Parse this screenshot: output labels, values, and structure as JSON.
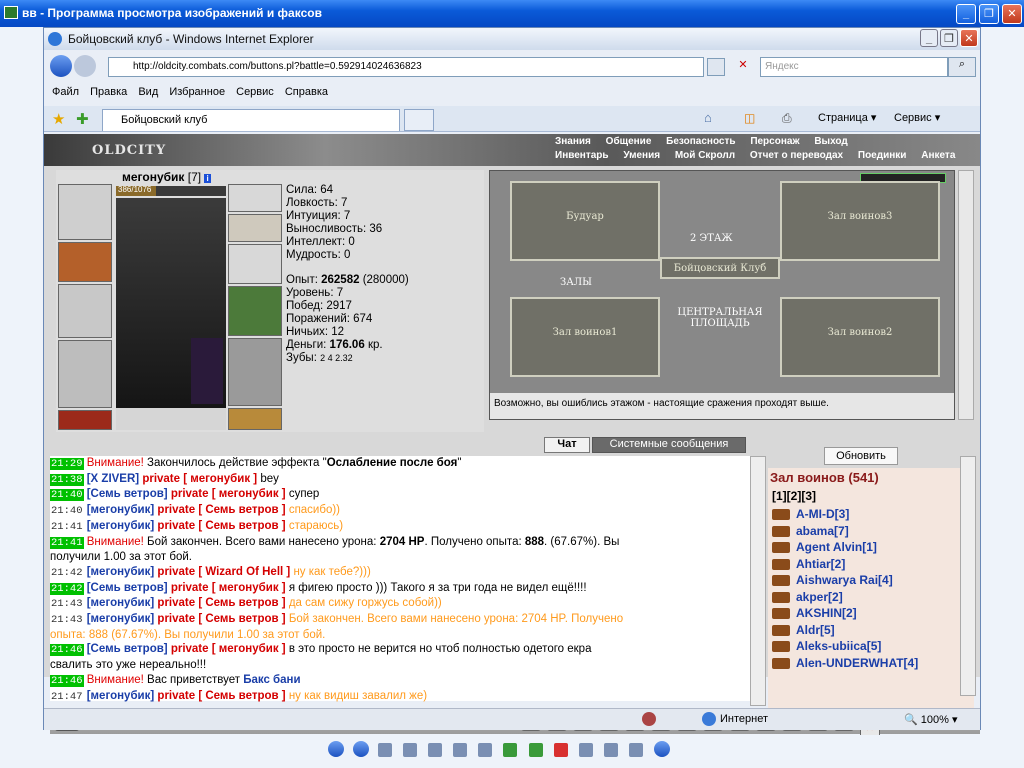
{
  "os_window": {
    "title": "вв - Программа просмотра изображений и факсов",
    "buttons": [
      "_",
      "❐",
      "✕"
    ]
  },
  "ie": {
    "title": "Бойцовский клуб - Windows Internet Explorer",
    "url": "http://oldcity.combats.com/buttons.pl?battle=0.592914024636823",
    "search_placeholder": "Яндекс",
    "menu": [
      "Файл",
      "Правка",
      "Вид",
      "Избранное",
      "Сервис",
      "Справка"
    ],
    "tab_title": "Бойцовский клуб",
    "toolbar_right": {
      "page": "Страница",
      "service": "Сервис"
    },
    "status": {
      "zone": "Интернет",
      "zoom": "100%"
    }
  },
  "game": {
    "logo": "OLDCITY",
    "menu_row1": [
      "Знания",
      "Общение",
      "Безопасность",
      "Персонаж",
      "Выход"
    ],
    "menu_row2": [
      "Инвентарь",
      "Умения",
      "Мой Скролл",
      "Отчет о переводах",
      "Поединки",
      "Анкета"
    ],
    "character": {
      "name": "мегонубик",
      "level": "[7]",
      "hp": "386/1076"
    },
    "stats": [
      {
        "label": "Сила",
        "value": "64"
      },
      {
        "label": "Ловкость",
        "value": "7"
      },
      {
        "label": "Интуиция",
        "value": "7"
      },
      {
        "label": "Выносливость",
        "value": "36"
      },
      {
        "label": "Интеллект",
        "value": "0"
      },
      {
        "label": "Мудрость",
        "value": "0"
      }
    ],
    "exp": {
      "label": "Опыт",
      "value": "262582",
      "next": "(280000)"
    },
    "stats2": [
      {
        "label": "Уровень",
        "value": "7"
      },
      {
        "label": "Побед",
        "value": "2917"
      },
      {
        "label": "Поражений",
        "value": "674"
      },
      {
        "label": "Ничьих",
        "value": "12"
      }
    ],
    "money": {
      "label": "Деньги",
      "value": "176.06",
      "unit": "кр."
    },
    "teeth": {
      "label": "Зубы",
      "value": "2 4 2.32"
    },
    "map": {
      "rooms": [
        "Будуар",
        "Зал воинов3",
        "2 ЭТАЖ",
        "Бойцовский Клуб",
        "ЗАЛЫ",
        "ЦЕНТРАЛЬНАЯ ПЛОЩАДЬ",
        "Зал воинов1",
        "Зал воинов2"
      ],
      "note": "Возможно, вы ошиблись этажом - настоящие сражения проходят выше."
    },
    "chat_tabs": [
      "Чат",
      "Системные сообщения"
    ],
    "refresh": "Обновить",
    "room_title": "Зал воинов (541)",
    "pages": "[1][2][3]",
    "users": [
      "A-MI-D[3]",
      "abama[7]",
      "Agent Alvin[1]",
      "Ahtiar[2]",
      "Aishwarya Rai[4]",
      "akper[2]",
      "AKSHIN[2]",
      "Aldr[5]",
      "Aleks-ubiica[5]",
      "Alen-UNDERWHAT[4]"
    ],
    "chat": [
      {
        "t": "21:29",
        "parts": [
          [
            "warn",
            "Внимание! "
          ],
          [
            "",
            "Закончилось действие эффекта \""
          ],
          [
            "b",
            "Ослабление после боя"
          ],
          [
            "",
            "\""
          ]
        ]
      },
      {
        "t": "21:38",
        "parts": [
          [
            "nick",
            "[X ZIVER] "
          ],
          [
            "pv",
            "private [ мегонубик ] "
          ],
          [
            "",
            "bey"
          ]
        ]
      },
      {
        "t": "21:40",
        "parts": [
          [
            "nick",
            "[Семь ветров] "
          ],
          [
            "pv",
            "private [ мегонубик ] "
          ],
          [
            "",
            "супер"
          ]
        ]
      },
      {
        "t": "21:40",
        "plain": true,
        "parts": [
          [
            "nick",
            "[мегонубик] "
          ],
          [
            "pv",
            "private [ Семь ветров ] "
          ],
          [
            "orange",
            "спасибо))"
          ]
        ]
      },
      {
        "t": "21:41",
        "plain": true,
        "parts": [
          [
            "nick",
            "[мегонубик] "
          ],
          [
            "pv",
            "private [ Семь ветров ] "
          ],
          [
            "orange",
            "стараюсь)"
          ]
        ]
      },
      {
        "t": "21:41",
        "parts": [
          [
            "warn",
            "Внимание! "
          ],
          [
            "",
            "Бой закончен. Всего вами нанесено урона: "
          ],
          [
            "b",
            "2704 HP"
          ],
          [
            "",
            ". Получено опыта: "
          ],
          [
            "b",
            "888"
          ],
          [
            "",
            ". (67.67%). Вы"
          ]
        ]
      },
      {
        "t": "",
        "parts": [
          [
            "",
            "получили 1.00 за этот бой."
          ]
        ]
      },
      {
        "t": "21:42",
        "plain": true,
        "parts": [
          [
            "nick",
            "[мегонубик] "
          ],
          [
            "pv",
            "private [ Wizard Of Hell ] "
          ],
          [
            "orange",
            "ну как тебе?)))"
          ]
        ]
      },
      {
        "t": "21:42",
        "parts": [
          [
            "nick",
            "[Семь ветров] "
          ],
          [
            "pv",
            "private [ мегонубик ] "
          ],
          [
            "",
            "я фигею просто ))) Такого я за три года не видел ещё!!!!"
          ]
        ]
      },
      {
        "t": "21:43",
        "plain": true,
        "parts": [
          [
            "nick",
            "[мегонубик] "
          ],
          [
            "pv",
            "private [ Семь ветров ] "
          ],
          [
            "orange",
            "да сам сижу горжусь собой))"
          ]
        ]
      },
      {
        "t": "21:43",
        "plain": true,
        "parts": [
          [
            "nick",
            "[мегонубик] "
          ],
          [
            "pv",
            "private [ Семь ветров ] "
          ],
          [
            "orange",
            "Бой закончен. Всего вами нанесено урона: 2704 HP. Получено"
          ]
        ]
      },
      {
        "t": "",
        "parts": [
          [
            "orange",
            "опыта: 888 (67.67%). Вы получили 1.00 за этот бой."
          ]
        ]
      },
      {
        "t": "21:46",
        "parts": [
          [
            "nick",
            "[Семь ветров] "
          ],
          [
            "pv",
            "private [ мегонубик ] "
          ],
          [
            "",
            "в это просто не верится но чтоб полностью одетого екра"
          ]
        ]
      },
      {
        "t": "",
        "parts": [
          [
            "",
            "свалить это уже нереально!!!"
          ]
        ]
      },
      {
        "t": "21:46",
        "parts": [
          [
            "warn",
            "Внимание! "
          ],
          [
            "",
            "Вас приветствует "
          ],
          [
            "nick",
            "Бакс бани"
          ]
        ]
      },
      {
        "t": "21:47",
        "plain": true,
        "parts": [
          [
            "nick",
            "[мегонубик] "
          ],
          [
            "pv",
            "private [ Семь ветров ] "
          ],
          [
            "orange",
            "ну как видиш завалил же)"
          ]
        ]
      }
    ]
  }
}
